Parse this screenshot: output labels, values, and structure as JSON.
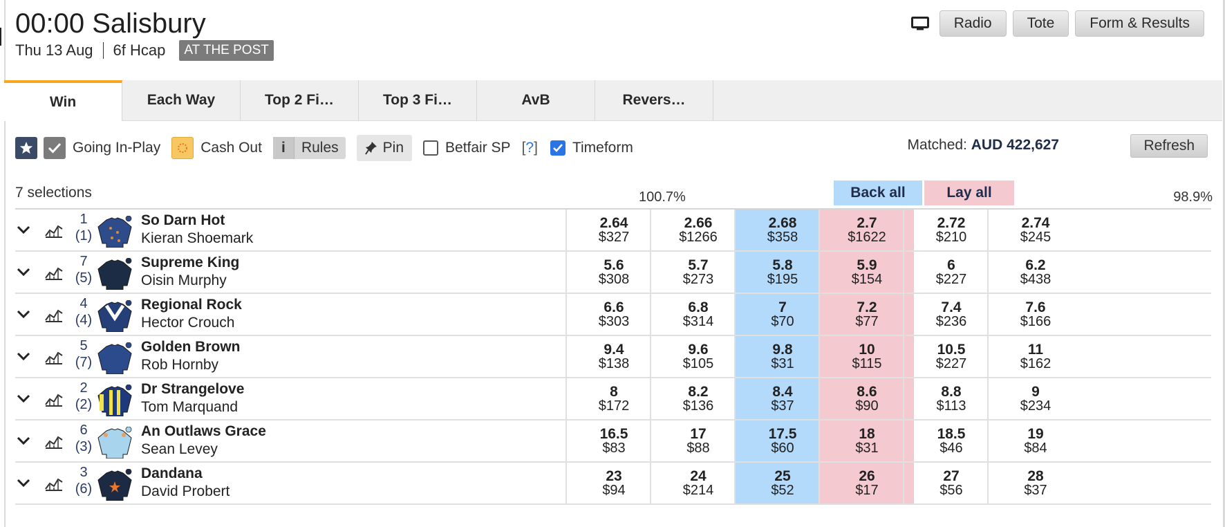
{
  "header": {
    "title": "00:00 Salisbury",
    "date": "Thu 13 Aug",
    "race_type": "6f Hcap",
    "status": "AT THE POST"
  },
  "top_buttons": {
    "tv_icon": "tv-icon",
    "radio": "Radio",
    "tote": "Tote",
    "form": "Form & Results"
  },
  "tabs": [
    {
      "label": "Win",
      "active": true
    },
    {
      "label": "Each Way"
    },
    {
      "label": "Top 2 Fi…"
    },
    {
      "label": "Top 3 Fi…"
    },
    {
      "label": "AvB"
    },
    {
      "label": "Revers…"
    }
  ],
  "toolbar": {
    "going_in_play": "Going In-Play",
    "cash_out": "Cash Out",
    "rules_i": "i",
    "rules": "Rules",
    "pin": "Pin",
    "betfair_sp": "Betfair SP",
    "help": "?",
    "timeform": "Timeform",
    "timeform_checked": true,
    "betfair_sp_checked": false
  },
  "matched": {
    "label": "Matched:",
    "amount": "AUD 422,627",
    "refresh": "Refresh"
  },
  "market": {
    "selections": "7 selections",
    "back_pct": "100.7%",
    "lay_pct": "98.9%",
    "back_all": "Back all",
    "lay_all": "Lay all"
  },
  "colors": {
    "accent": "#f5a623",
    "back": "#b3d9fb",
    "lay": "#f4c9d0"
  },
  "runners": [
    {
      "number": "1",
      "draw": "(1)",
      "name": "So Darn Hot",
      "jockey": "Kieran Shoemark",
      "silk": "blue-with-orange-stars",
      "prices": [
        [
          "2.64",
          "$327"
        ],
        [
          "2.66",
          "$1266"
        ],
        [
          "2.68",
          "$358"
        ],
        [
          "2.7",
          "$1622"
        ],
        [
          "2.72",
          "$210"
        ],
        [
          "2.74",
          "$245"
        ]
      ]
    },
    {
      "number": "7",
      "draw": "(5)",
      "name": "Supreme King",
      "jockey": "Oisin Murphy",
      "silk": "dark-navy",
      "prices": [
        [
          "5.6",
          "$308"
        ],
        [
          "5.7",
          "$273"
        ],
        [
          "5.8",
          "$195"
        ],
        [
          "5.9",
          "$154"
        ],
        [
          "6",
          "$227"
        ],
        [
          "6.2",
          "$438"
        ]
      ]
    },
    {
      "number": "4",
      "draw": "(4)",
      "name": "Regional Rock",
      "jockey": "Hector Crouch",
      "silk": "navy-white-chevron",
      "prices": [
        [
          "6.6",
          "$303"
        ],
        [
          "6.8",
          "$314"
        ],
        [
          "7",
          "$70"
        ],
        [
          "7.2",
          "$77"
        ],
        [
          "7.4",
          "$236"
        ],
        [
          "7.6",
          "$166"
        ]
      ]
    },
    {
      "number": "5",
      "draw": "(7)",
      "name": "Golden Brown",
      "jockey": "Rob Hornby",
      "silk": "royal-blue",
      "prices": [
        [
          "9.4",
          "$138"
        ],
        [
          "9.6",
          "$105"
        ],
        [
          "9.8",
          "$31"
        ],
        [
          "10",
          "$115"
        ],
        [
          "10.5",
          "$227"
        ],
        [
          "11",
          "$162"
        ]
      ]
    },
    {
      "number": "2",
      "draw": "(2)",
      "name": "Dr Strangelove",
      "jockey": "Tom Marquand",
      "silk": "navy-yellow-stripes",
      "prices": [
        [
          "8",
          "$172"
        ],
        [
          "8.2",
          "$136"
        ],
        [
          "8.4",
          "$37"
        ],
        [
          "8.6",
          "$90"
        ],
        [
          "8.8",
          "$113"
        ],
        [
          "9",
          "$234"
        ]
      ]
    },
    {
      "number": "6",
      "draw": "(3)",
      "name": "An Outlaws Grace",
      "jockey": "Sean Levey",
      "silk": "light-blue",
      "prices": [
        [
          "16.5",
          "$83"
        ],
        [
          "17",
          "$88"
        ],
        [
          "17.5",
          "$60"
        ],
        [
          "18",
          "$31"
        ],
        [
          "18.5",
          "$46"
        ],
        [
          "19",
          "$84"
        ]
      ]
    },
    {
      "number": "3",
      "draw": "(6)",
      "name": "Dandana",
      "jockey": "David Probert",
      "silk": "navy-orange-star",
      "prices": [
        [
          "23",
          "$94"
        ],
        [
          "24",
          "$214"
        ],
        [
          "25",
          "$52"
        ],
        [
          "26",
          "$17"
        ],
        [
          "27",
          "$56"
        ],
        [
          "28",
          "$37"
        ]
      ]
    }
  ]
}
